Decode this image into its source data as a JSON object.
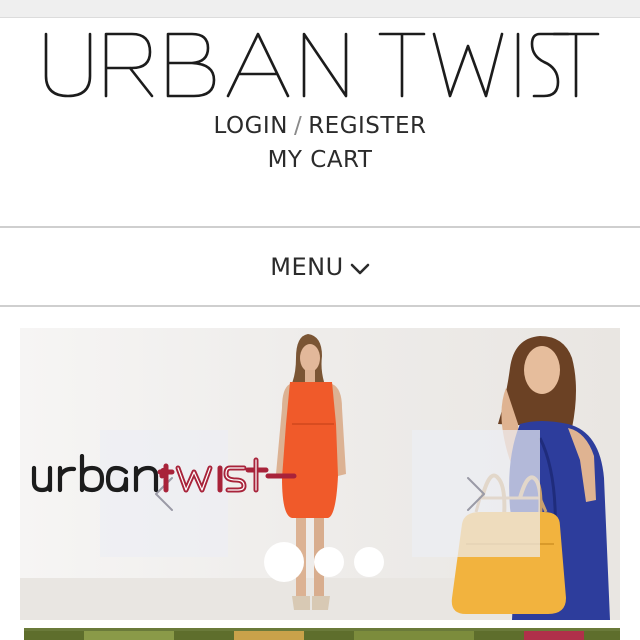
{
  "brand": {
    "logo_text": "URBAN TWIST"
  },
  "account": {
    "login_label": "LOGIN",
    "separator": "/",
    "register_label": "REGISTER",
    "cart_label": "MY CART"
  },
  "menu": {
    "label": "MENU",
    "icon": "chevron-down-icon"
  },
  "slider": {
    "logo_text": "urban twist",
    "prev_icon": "chevron-left-icon",
    "next_icon": "chevron-right-icon",
    "slide_count": 3,
    "active_slide": 1
  },
  "colors": {
    "text": "#2b2b2b",
    "divider": "#cfcfcf",
    "dress_orange": "#f05a2a",
    "dress_blue": "#2d3d9c",
    "bag_yellow": "#f2b33e",
    "logo_red": "#a8233a"
  }
}
